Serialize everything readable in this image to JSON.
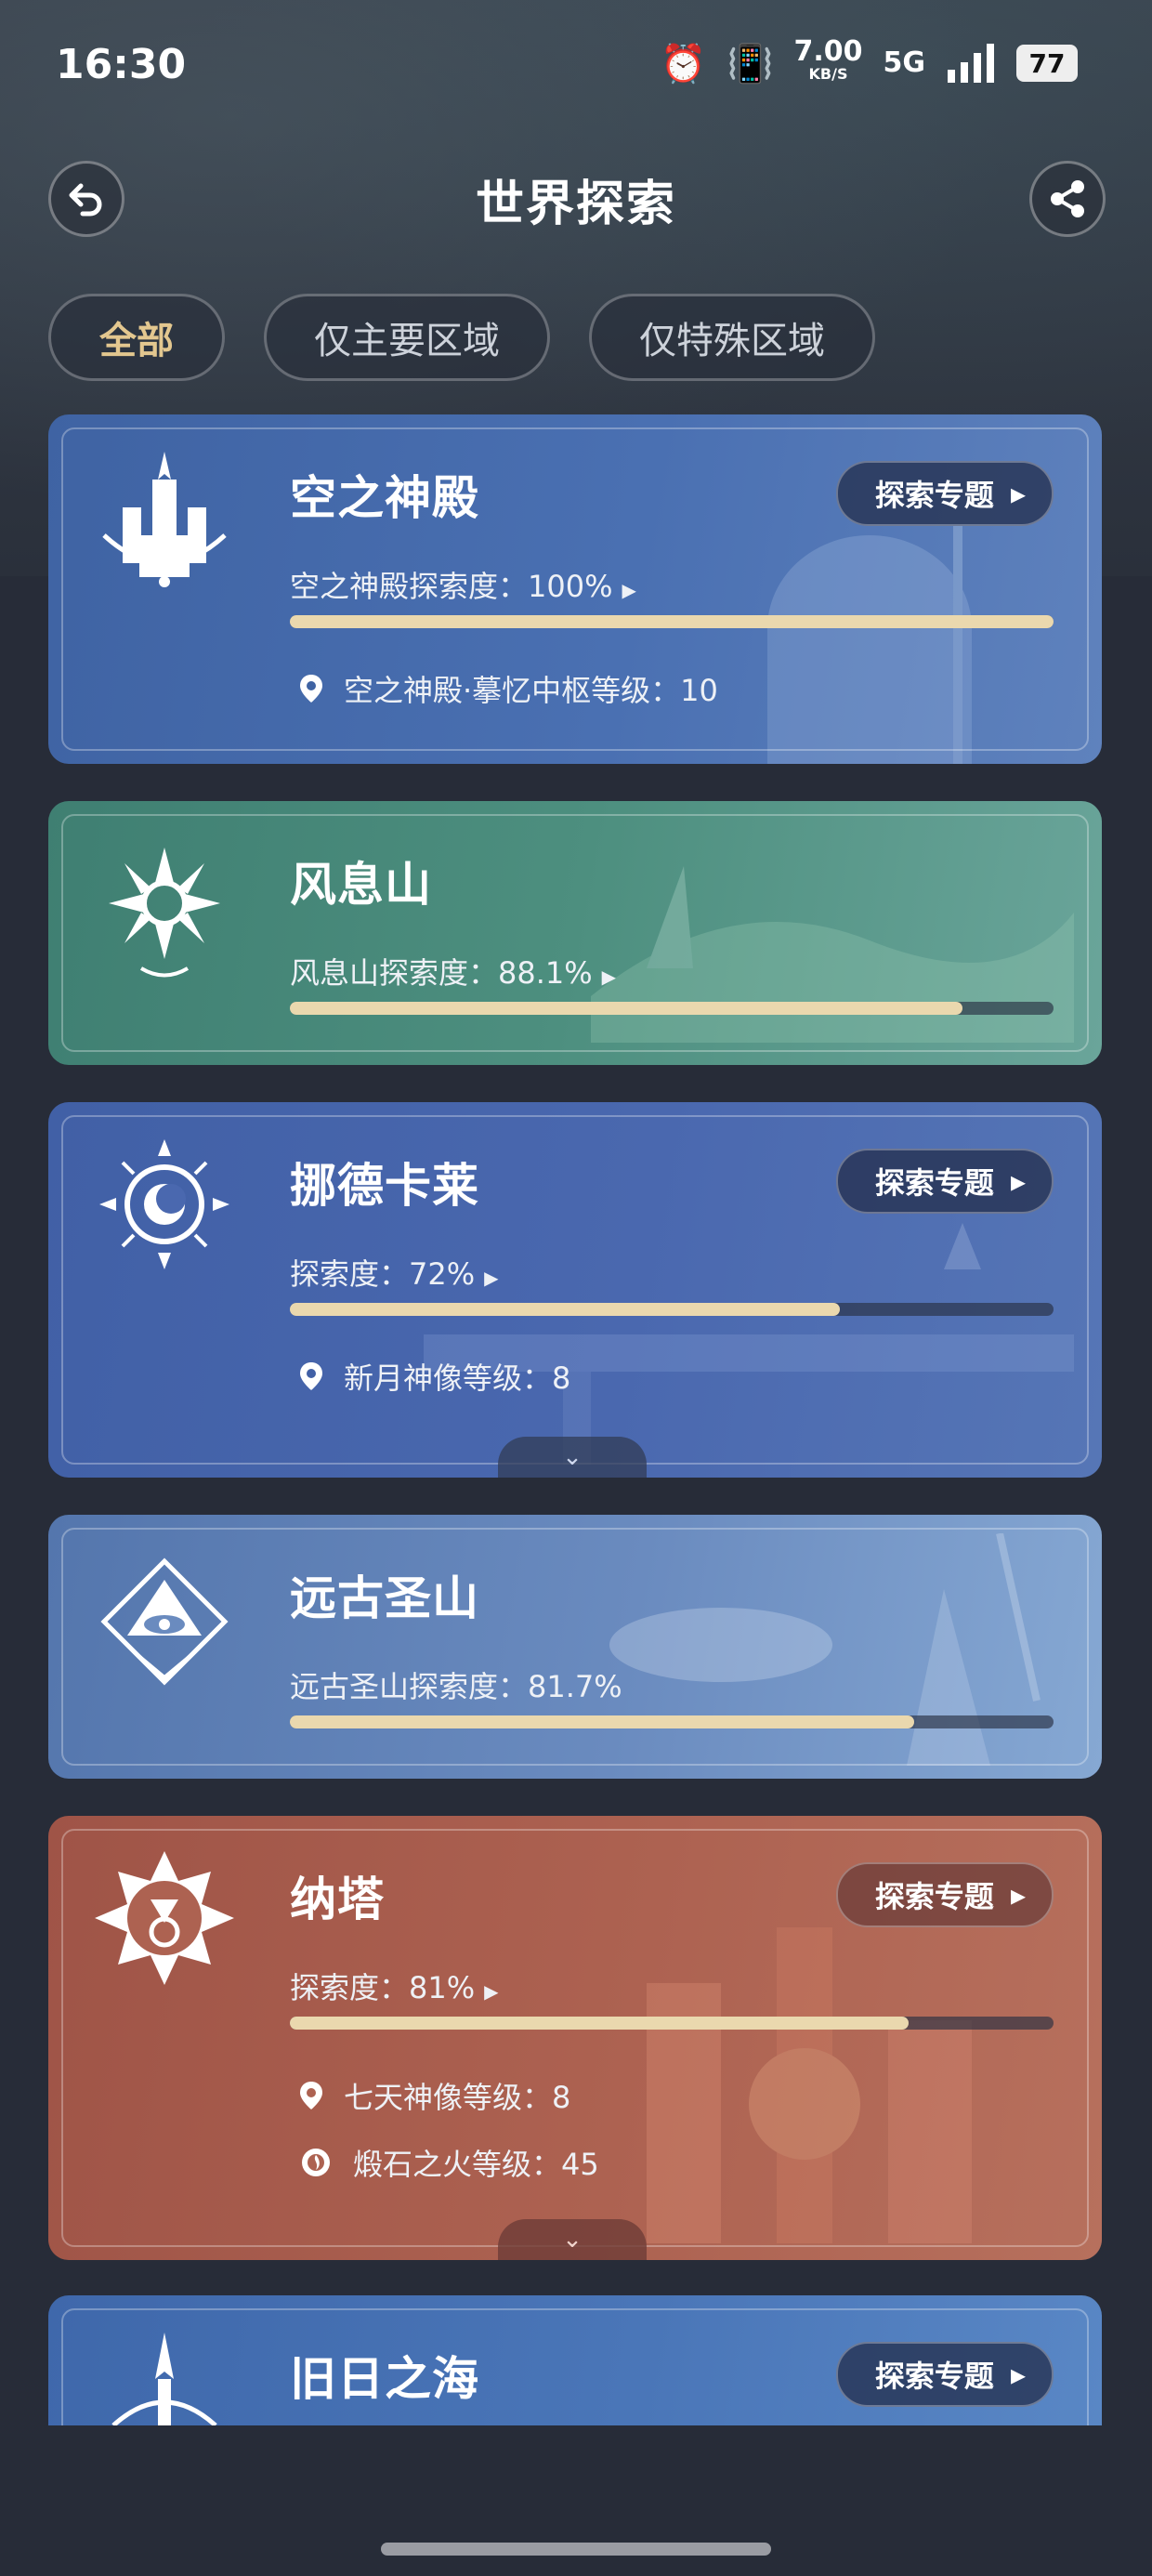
{
  "status_bar": {
    "time": "16:30",
    "net_speed": "7.00",
    "net_unit": "KB/S",
    "network": "5G",
    "battery": "77"
  },
  "header": {
    "title": "世界探索",
    "back_icon": "back-arrow-icon",
    "share_icon": "share-icon"
  },
  "tabs": [
    {
      "label": "全部",
      "active": true
    },
    {
      "label": "仅主要区域",
      "active": false
    },
    {
      "label": "仅特殊区域",
      "active": false
    }
  ],
  "regions": [
    {
      "name": "空之神殿",
      "topic_label": "探索专题",
      "progress_label": "空之神殿探索度：",
      "progress_value": "100%",
      "progress": 1.0,
      "subs": [
        {
          "icon": "map-pin-icon",
          "text": "空之神殿·摹忆中枢等级：10"
        }
      ],
      "theme": "#4a6fb0"
    },
    {
      "name": "风息山",
      "progress_label": "风息山探索度：",
      "progress_value": "88.1%",
      "progress": 0.881,
      "subs": [],
      "theme": "#4e8d82"
    },
    {
      "name": "挪德卡莱",
      "topic_label": "探索专题",
      "progress_label": "探索度：",
      "progress_value": "72%",
      "progress": 0.72,
      "subs": [
        {
          "icon": "map-pin-icon",
          "text": "新月神像等级：8"
        }
      ],
      "theme": "#4967aa"
    },
    {
      "name": "远古圣山",
      "progress_label": "远古圣山探索度：",
      "progress_value": "81.7%",
      "progress": 0.817,
      "subs": [],
      "theme": "#5c7fae"
    },
    {
      "name": "纳塔",
      "topic_label": "探索专题",
      "progress_label": "探索度：",
      "progress_value": "81%",
      "progress": 0.81,
      "subs": [
        {
          "icon": "map-pin-icon",
          "text": "七天神像等级：8"
        },
        {
          "icon": "fire-gear-icon",
          "text": "煅石之火等级：45"
        }
      ],
      "theme": "#a65c4f"
    },
    {
      "name": "旧日之海",
      "topic_label": "探索专题",
      "theme": "#4b79b6"
    }
  ]
}
